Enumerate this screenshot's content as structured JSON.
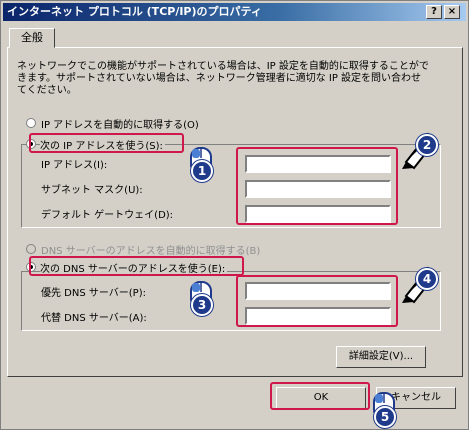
{
  "window": {
    "title": "インターネット プロトコル (TCP/IP)のプロパティ",
    "help_label": "?",
    "close_label": "×"
  },
  "tab": {
    "label": "全般"
  },
  "description": "ネットワークでこの機能がサポートされている場合は、IP 設定を自動的に取得することがで\nきます。サポートされていない場合は、ネットワーク管理者に適切な IP 設定を問い合わせ\nてください。",
  "ip": {
    "auto_label": "IP アドレスを自動的に取得する(O)",
    "manual_label": "次の IP アドレスを使う(S):",
    "address_label": "IP アドレス(I):",
    "subnet_label": "サブネット マスク(U):",
    "gateway_label": "デフォルト ゲートウェイ(D):",
    "address_value": "",
    "subnet_value": "",
    "gateway_value": ""
  },
  "dns": {
    "auto_label": "DNS サーバーのアドレスを自動的に取得する(B)",
    "manual_label": "次の DNS サーバーのアドレスを使う(E):",
    "preferred_label": "優先 DNS サーバー(P):",
    "alternate_label": "代替 DNS サーバー(A):",
    "preferred_value": "",
    "alternate_value": ""
  },
  "advanced_label": "詳細設定(V)...",
  "ok_label": "OK",
  "cancel_label": "キャンセル",
  "steps": {
    "one": "1",
    "two": "2",
    "three": "3",
    "four": "4",
    "five": "5"
  },
  "colors": {
    "highlight": "#d0174b",
    "title": "#0a246a",
    "badge": "#1f3a8a"
  }
}
